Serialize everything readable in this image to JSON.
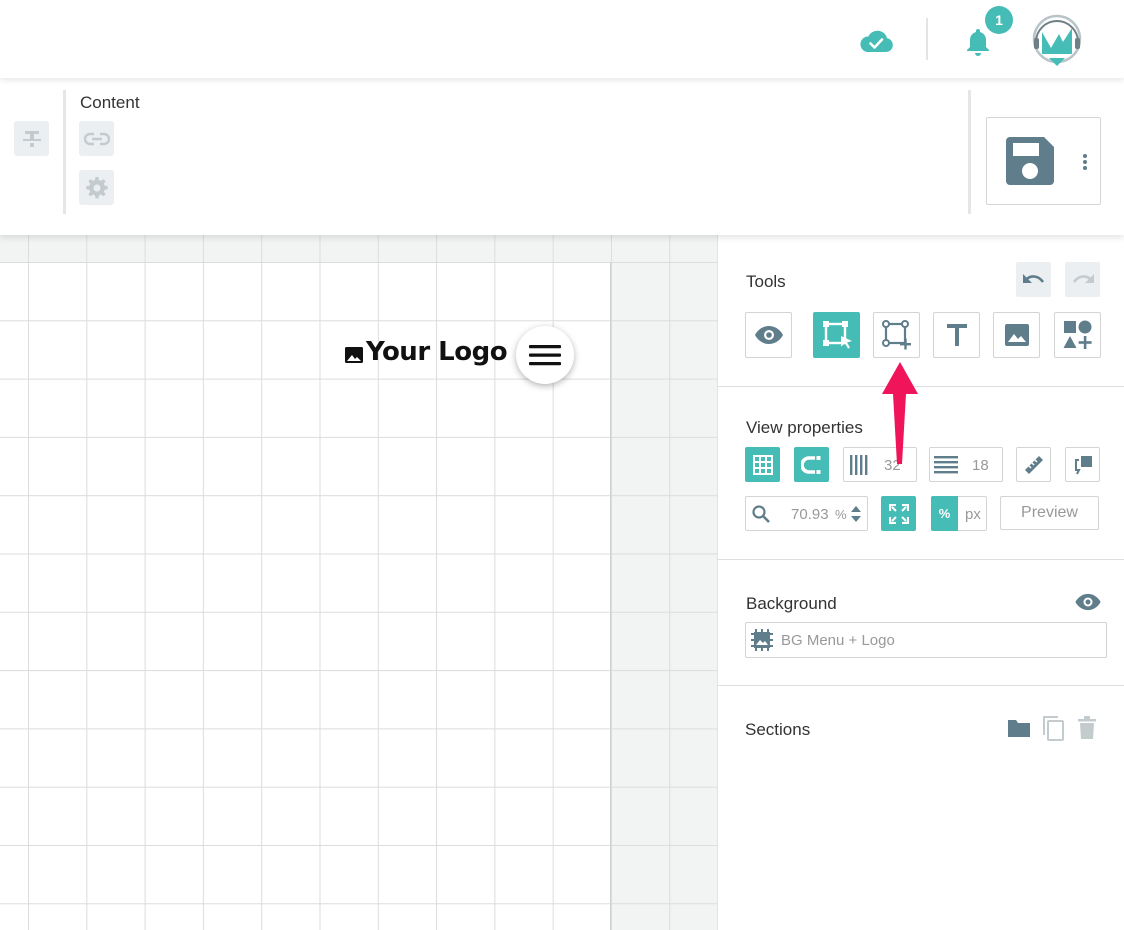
{
  "topbar": {
    "notification_count": "1"
  },
  "ribbon": {
    "content_label": "Content"
  },
  "canvas": {
    "logo_text": "Your Logo"
  },
  "panel": {
    "tools_title": "Tools",
    "view_properties_title": "View properties",
    "columns_value": "32",
    "rows_value": "18",
    "zoom_value": "70.93",
    "zoom_unit": "%",
    "unit_percent": "%",
    "unit_px": "px",
    "preview_label": "Preview",
    "background_title": "Background",
    "background_field_placeholder": "BG Menu + Logo",
    "sections_title": "Sections"
  },
  "colors": {
    "accent": "#45bcb6",
    "icon_grey": "#5f7a82",
    "annotation": "#f0145a"
  }
}
